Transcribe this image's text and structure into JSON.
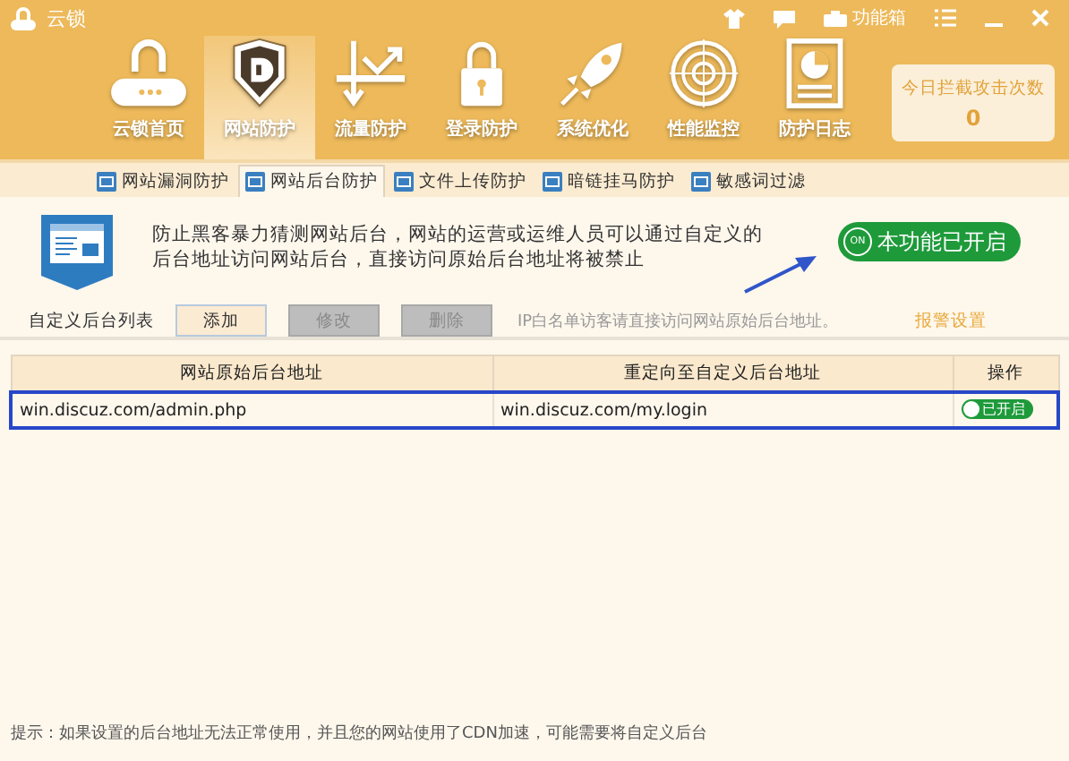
{
  "window": {
    "title": "云锁"
  },
  "title_bar": {
    "toolbox_label": "功能箱"
  },
  "nav": {
    "items": [
      {
        "label": "云锁首页",
        "kind": "cloud",
        "selected": false
      },
      {
        "label": "网站防护",
        "kind": "shield",
        "selected": true
      },
      {
        "label": "流量防护",
        "kind": "flow",
        "selected": false
      },
      {
        "label": "登录防护",
        "kind": "lock",
        "selected": false
      },
      {
        "label": "系统优化",
        "kind": "rocket",
        "selected": false
      },
      {
        "label": "性能监控",
        "kind": "radar",
        "selected": false
      },
      {
        "label": "防护日志",
        "kind": "report",
        "selected": false
      }
    ]
  },
  "counter": {
    "label": "今日拦截攻击次数",
    "value": "0"
  },
  "sub_tabs": [
    {
      "label": "网站漏洞防护",
      "selected": false
    },
    {
      "label": "网站后台防护",
      "selected": true
    },
    {
      "label": "文件上传防护",
      "selected": false
    },
    {
      "label": "暗链挂马防护",
      "selected": false
    },
    {
      "label": "敏感词过滤",
      "selected": false
    }
  ],
  "feature": {
    "description": "防止黑客暴力猜测网站后台，网站的运营或运维人员可以通过自定义的后台地址访问网站后台，直接访问原始后台地址将被禁止",
    "toggle": {
      "badge": "ON",
      "label": "本功能已开启",
      "on": true
    }
  },
  "list": {
    "label": "自定义后台列表",
    "buttons": [
      {
        "label": "添加",
        "disabled": false
      },
      {
        "label": "修改",
        "disabled": true
      },
      {
        "label": "删除",
        "disabled": true
      }
    ],
    "note": "IP白名单访客请直接访问网站原始后台地址。",
    "alarm_link": "报警设置"
  },
  "table": {
    "columns": [
      "网站原始后台地址",
      "重定向至自定义后台地址",
      "操作"
    ],
    "rows": [
      {
        "original": "win.discuz.com/admin.php",
        "redirect": "win.discuz.com/my.login",
        "status": "已开启",
        "on": true,
        "selected": true
      }
    ]
  },
  "tip": "提示：如果设置的后台地址无法正常使用，并且您的网站使用了CDN加速，可能需要将自定义后台"
}
